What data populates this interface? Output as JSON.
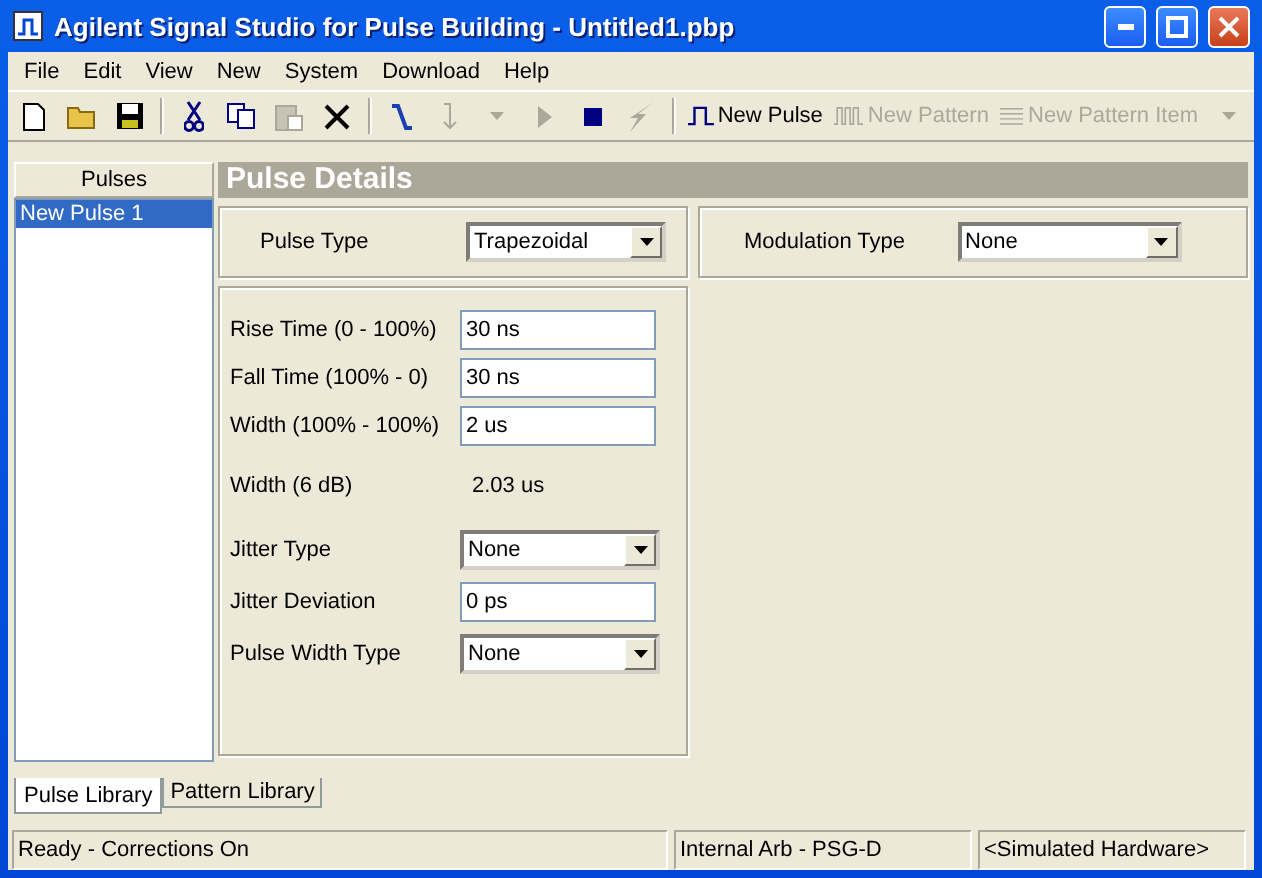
{
  "window": {
    "title": "Agilent Signal Studio for Pulse Building - Untitled1.pbp"
  },
  "menu": [
    "File",
    "Edit",
    "View",
    "New",
    "System",
    "Download",
    "Help"
  ],
  "toolbar": [
    {
      "kind": "new",
      "disabled": false
    },
    {
      "kind": "open",
      "disabled": false
    },
    {
      "kind": "save",
      "disabled": false
    },
    {
      "kind": "separator"
    },
    {
      "kind": "cut",
      "disabled": false
    },
    {
      "kind": "copy",
      "disabled": false
    },
    {
      "kind": "paste",
      "disabled": true
    },
    {
      "kind": "delete",
      "disabled": false
    },
    {
      "kind": "separator"
    },
    {
      "kind": "connect",
      "disabled": false
    },
    {
      "kind": "step",
      "disabled": true
    },
    {
      "kind": "caret",
      "disabled": true
    },
    {
      "kind": "play",
      "disabled": true
    },
    {
      "kind": "stop",
      "disabled": false
    },
    {
      "kind": "bolt",
      "disabled": true
    },
    {
      "kind": "separator"
    },
    {
      "kind": "pulse",
      "label": "New Pulse",
      "disabled": false
    },
    {
      "kind": "pattern",
      "label": "New Pattern",
      "disabled": true
    },
    {
      "kind": "list",
      "label": "New Pattern Item",
      "disabled": true
    },
    {
      "kind": "caret",
      "disabled": true
    }
  ],
  "pulses": {
    "header": "Pulses",
    "items": [
      {
        "label": "New Pulse 1",
        "selected": true
      }
    ]
  },
  "details": {
    "title": "Pulse Details",
    "pulse_type": {
      "label": "Pulse Type",
      "value": "Trapezoidal"
    },
    "modulation_type": {
      "label": "Modulation Type",
      "value": "None"
    },
    "params": [
      {
        "kind": "text",
        "label": "Rise Time (0 - 100%)",
        "value": "30 ns"
      },
      {
        "kind": "text",
        "label": "Fall Time (100% - 0)",
        "value": "30 ns"
      },
      {
        "kind": "text",
        "label": "Width (100% - 100%)",
        "value": "2 us"
      },
      {
        "kind": "readout",
        "label": "Width (6 dB)",
        "value": "2.03 us"
      },
      {
        "kind": "select",
        "label": "Jitter Type",
        "value": "None"
      },
      {
        "kind": "text",
        "label": "Jitter Deviation",
        "value": "0 ps"
      },
      {
        "kind": "select",
        "label": "Pulse Width Type",
        "value": "None"
      }
    ]
  },
  "tabs": [
    {
      "label": "Pulse Library",
      "selected": true
    },
    {
      "label": "Pattern Library",
      "selected": false
    }
  ],
  "status_bar": [
    "Ready - Corrections On",
    "Internal Arb - PSG-D",
    "<Simulated Hardware>"
  ]
}
